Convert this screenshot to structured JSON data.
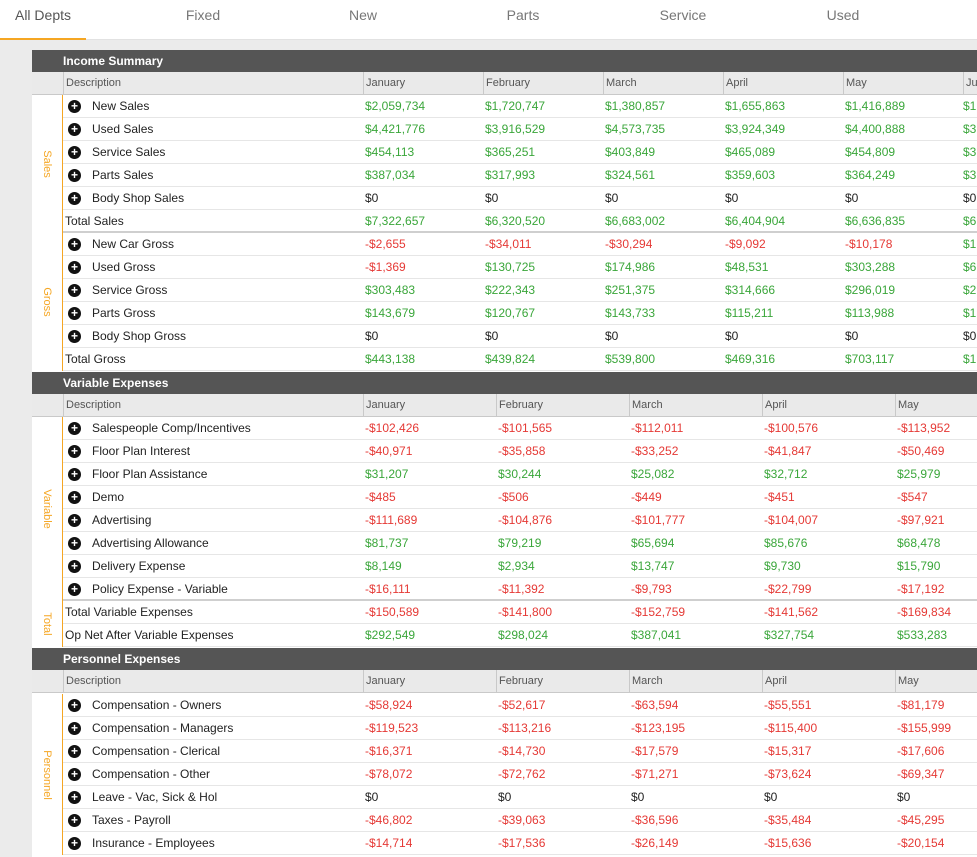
{
  "tabs": [
    "All Depts",
    "Fixed",
    "New",
    "Parts",
    "Service",
    "Used"
  ],
  "active_tab": 0,
  "sections": [
    {
      "title": "Income Summary",
      "columns": [
        "Description",
        "January",
        "February",
        "March",
        "April",
        "May",
        "Ju"
      ],
      "groups": [
        {
          "label": "Sales",
          "rows": [
            {
              "label": "New Sales",
              "expand": true,
              "values": [
                "$2,059,734",
                "$1,720,747",
                "$1,380,857",
                "$1,655,863",
                "$1,416,889",
                "$1"
              ]
            },
            {
              "label": "Used Sales",
              "expand": true,
              "values": [
                "$4,421,776",
                "$3,916,529",
                "$4,573,735",
                "$3,924,349",
                "$4,400,888",
                "$3"
              ]
            },
            {
              "label": "Service Sales",
              "expand": true,
              "values": [
                "$454,113",
                "$365,251",
                "$403,849",
                "$465,089",
                "$454,809",
                "$3"
              ]
            },
            {
              "label": "Parts Sales",
              "expand": true,
              "values": [
                "$387,034",
                "$317,993",
                "$324,561",
                "$359,603",
                "$364,249",
                "$3"
              ]
            },
            {
              "label": "Body Shop Sales",
              "expand": true,
              "values": [
                "$0",
                "$0",
                "$0",
                "$0",
                "$0",
                "$0"
              ]
            },
            {
              "label": "Total Sales",
              "expand": false,
              "values": [
                "$7,322,657",
                "$6,320,520",
                "$6,683,002",
                "$6,404,904",
                "$6,636,835",
                "$6"
              ]
            }
          ]
        },
        {
          "label": "Gross",
          "rows": [
            {
              "label": "New Car Gross",
              "expand": true,
              "values": [
                "-$2,655",
                "-$34,011",
                "-$30,294",
                "-$9,092",
                "-$10,178",
                "$1"
              ]
            },
            {
              "label": "Used Gross",
              "expand": true,
              "values": [
                "-$1,369",
                "$130,725",
                "$174,986",
                "$48,531",
                "$303,288",
                "$6"
              ]
            },
            {
              "label": "Service Gross",
              "expand": true,
              "values": [
                "$303,483",
                "$222,343",
                "$251,375",
                "$314,666",
                "$296,019",
                "$2"
              ]
            },
            {
              "label": "Parts Gross",
              "expand": true,
              "values": [
                "$143,679",
                "$120,767",
                "$143,733",
                "$115,211",
                "$113,988",
                "$1"
              ]
            },
            {
              "label": "Body Shop Gross",
              "expand": true,
              "values": [
                "$0",
                "$0",
                "$0",
                "$0",
                "$0",
                "$0"
              ]
            },
            {
              "label": "Total Gross",
              "expand": false,
              "values": [
                "$443,138",
                "$439,824",
                "$539,800",
                "$469,316",
                "$703,117",
                "$1"
              ]
            }
          ]
        }
      ]
    },
    {
      "title": "Variable Expenses",
      "columns": [
        "Description",
        "January",
        "February",
        "March",
        "April",
        "May"
      ],
      "groups": [
        {
          "label": "Variable",
          "rows": [
            {
              "label": "Salespeople Comp/Incentives",
              "expand": true,
              "values": [
                "-$102,426",
                "-$101,565",
                "-$112,011",
                "-$100,576",
                "-$113,952"
              ]
            },
            {
              "label": "Floor Plan Interest",
              "expand": true,
              "values": [
                "-$40,971",
                "-$35,858",
                "-$33,252",
                "-$41,847",
                "-$50,469"
              ]
            },
            {
              "label": "Floor Plan Assistance",
              "expand": true,
              "values": [
                "$31,207",
                "$30,244",
                "$25,082",
                "$32,712",
                "$25,979"
              ]
            },
            {
              "label": "Demo",
              "expand": true,
              "values": [
                "-$485",
                "-$506",
                "-$449",
                "-$451",
                "-$547"
              ]
            },
            {
              "label": "Advertising",
              "expand": true,
              "values": [
                "-$111,689",
                "-$104,876",
                "-$101,777",
                "-$104,007",
                "-$97,921"
              ]
            },
            {
              "label": "Advertising Allowance",
              "expand": true,
              "values": [
                "$81,737",
                "$79,219",
                "$65,694",
                "$85,676",
                "$68,478"
              ]
            },
            {
              "label": "Delivery Expense",
              "expand": true,
              "values": [
                "$8,149",
                "$2,934",
                "$13,747",
                "$9,730",
                "$15,790"
              ]
            },
            {
              "label": "Policy Expense - Variable",
              "expand": true,
              "values": [
                "-$16,111",
                "-$11,392",
                "-$9,793",
                "-$22,799",
                "-$17,192"
              ]
            }
          ]
        },
        {
          "label": "Total",
          "rows": [
            {
              "label": "Total Variable Expenses",
              "expand": false,
              "values": [
                "-$150,589",
                "-$141,800",
                "-$152,759",
                "-$141,562",
                "-$169,834"
              ]
            },
            {
              "label": "Op Net After Variable Expenses",
              "expand": false,
              "values": [
                "$292,549",
                "$298,024",
                "$387,041",
                "$327,754",
                "$533,283"
              ]
            }
          ]
        }
      ]
    },
    {
      "title": "Personnel Expenses",
      "columns": [
        "Description",
        "January",
        "February",
        "March",
        "April",
        "May"
      ],
      "groups": [
        {
          "label": "Personnel",
          "rows": [
            {
              "label": "Compensation - Owners",
              "expand": true,
              "values": [
                "-$58,924",
                "-$52,617",
                "-$63,594",
                "-$55,551",
                "-$81,179"
              ]
            },
            {
              "label": "Compensation - Managers",
              "expand": true,
              "values": [
                "-$119,523",
                "-$113,216",
                "-$123,195",
                "-$115,400",
                "-$155,999"
              ]
            },
            {
              "label": "Compensation - Clerical",
              "expand": true,
              "values": [
                "-$16,371",
                "-$14,730",
                "-$17,579",
                "-$15,317",
                "-$17,606"
              ]
            },
            {
              "label": "Compensation - Other",
              "expand": true,
              "values": [
                "-$78,072",
                "-$72,762",
                "-$71,271",
                "-$73,624",
                "-$69,347"
              ]
            },
            {
              "label": "Leave - Vac, Sick & Hol",
              "expand": true,
              "values": [
                "$0",
                "$0",
                "$0",
                "$0",
                "$0"
              ]
            },
            {
              "label": "Taxes - Payroll",
              "expand": true,
              "values": [
                "-$46,802",
                "-$39,063",
                "-$36,596",
                "-$35,484",
                "-$45,295"
              ]
            },
            {
              "label": "Insurance - Employees",
              "expand": true,
              "values": [
                "-$14,714",
                "-$17,536",
                "-$26,149",
                "-$15,636",
                "-$20,154"
              ]
            }
          ]
        }
      ]
    }
  ],
  "colors": {
    "positive": "#3aa63a",
    "negative": "#e53935",
    "accent": "#f5a623",
    "section_header": "#555555"
  },
  "icons": {
    "expand": "plus-circle-icon"
  }
}
